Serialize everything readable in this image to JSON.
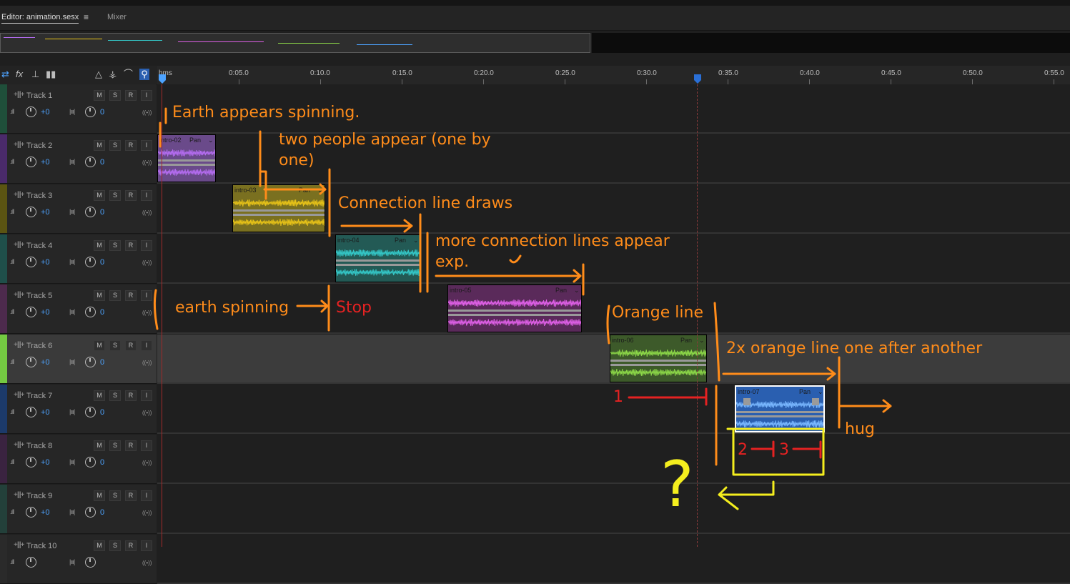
{
  "tabs": {
    "editor_label": "Editor: animation.sesx",
    "menu_icon": "≡",
    "mixer_label": "Mixer"
  },
  "toolbar": {
    "fx_label": "fx"
  },
  "ruler": {
    "labels": [
      "hms",
      "0:05.0",
      "0:10.0",
      "0:15.0",
      "0:20.0",
      "0:25.0",
      "0:30.0",
      "0:35.0",
      "0:40.0",
      "0:45.0",
      "0:50.0",
      "0:55.0"
    ]
  },
  "track_buttons": {
    "m": "M",
    "s": "S",
    "r": "R",
    "i": "I"
  },
  "tracks": [
    {
      "name": "Track 1",
      "volume": "+0",
      "pan": "0",
      "color": "#1f4f3a"
    },
    {
      "name": "Track 2",
      "volume": "+0",
      "pan": "0",
      "color": "#4a2a6a"
    },
    {
      "name": "Track 3",
      "volume": "+0",
      "pan": "0",
      "color": "#5b5412"
    },
    {
      "name": "Track 4",
      "volume": "+0",
      "pan": "0",
      "color": "#1f4f4a"
    },
    {
      "name": "Track 5",
      "volume": "+0",
      "pan": "0",
      "color": "#4d2a4d"
    },
    {
      "name": "Track 6",
      "volume": "+0",
      "pan": "0",
      "color": "#74c942"
    },
    {
      "name": "Track 7",
      "volume": "+0",
      "pan": "0",
      "color": "#1c3a6a"
    },
    {
      "name": "Track 8",
      "volume": "+0",
      "pan": "0",
      "color": "#3a2340"
    },
    {
      "name": "Track 9",
      "volume": "+0",
      "pan": "0",
      "color": "#23403a"
    },
    {
      "name": "Track 10",
      "volume": "",
      "pan": "",
      "color": "#2a2a2a"
    }
  ],
  "clips": [
    {
      "name": "intro-02",
      "pan": "Pan",
      "color": "#6a4a8a",
      "wave": "#b46cf0"
    },
    {
      "name": "intro-03",
      "pan": "Pan",
      "color": "#7a7020",
      "wave": "#e8c318"
    },
    {
      "name": "intro-04",
      "pan": "Pan",
      "color": "#235a55",
      "wave": "#34c8c8"
    },
    {
      "name": "intro-05",
      "pan": "Pan",
      "color": "#5a2a5a",
      "wave": "#e060e8"
    },
    {
      "name": "intro-06",
      "pan": "Pan",
      "color": "#3d5a2a",
      "wave": "#8cd848"
    },
    {
      "name": "intro-07",
      "pan": "Pan",
      "color": "#2a5fb0",
      "wave": "#7ab8ff"
    }
  ],
  "annotations": {
    "earth_appears": "Earth appears spinning.",
    "two_people": "two people appear (one by",
    "two_people_2": "one)",
    "connection_line": "Connection line draws",
    "more_lines": "more connection lines appear",
    "more_lines_2": "exp.",
    "earth_spinning": "earth spinning",
    "stop": "Stop",
    "orange_line": "Orange line",
    "two_orange": "2x orange line one after another",
    "hug": "hug",
    "n1": "1",
    "n2": "2",
    "n3": "3",
    "question": "?"
  },
  "colors": {
    "annotation_orange": "#ff8c1a",
    "annotation_red": "#e52222",
    "annotation_yellow": "#f4ee1e",
    "accent_blue": "#4da3ff"
  }
}
